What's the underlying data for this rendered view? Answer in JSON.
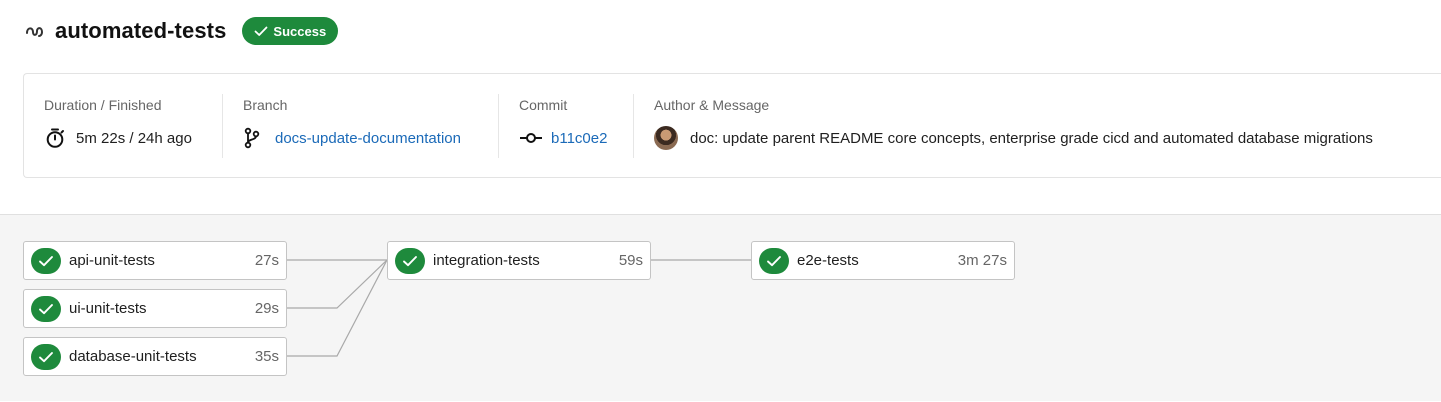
{
  "workflow": {
    "title": "automated-tests",
    "status": "Success",
    "colors": {
      "success": "#1e8a3c",
      "link": "#1b6ab8"
    }
  },
  "info": {
    "duration_label": "Duration / Finished",
    "duration_value": "5m 22s / 24h ago",
    "branch_label": "Branch",
    "branch_value": "docs-update-documentation",
    "commit_label": "Commit",
    "commit_value": "b11c0e2",
    "author_label": "Author & Message",
    "message": "doc: update parent README core concepts, enterprise grade cicd and automated database migrations"
  },
  "jobs": [
    {
      "name": "api-unit-tests",
      "duration": "27s",
      "status": "success"
    },
    {
      "name": "ui-unit-tests",
      "duration": "29s",
      "status": "success"
    },
    {
      "name": "database-unit-tests",
      "duration": "35s",
      "status": "success"
    },
    {
      "name": "integration-tests",
      "duration": "59s",
      "status": "success"
    },
    {
      "name": "e2e-tests",
      "duration": "3m 27s",
      "status": "success"
    }
  ]
}
